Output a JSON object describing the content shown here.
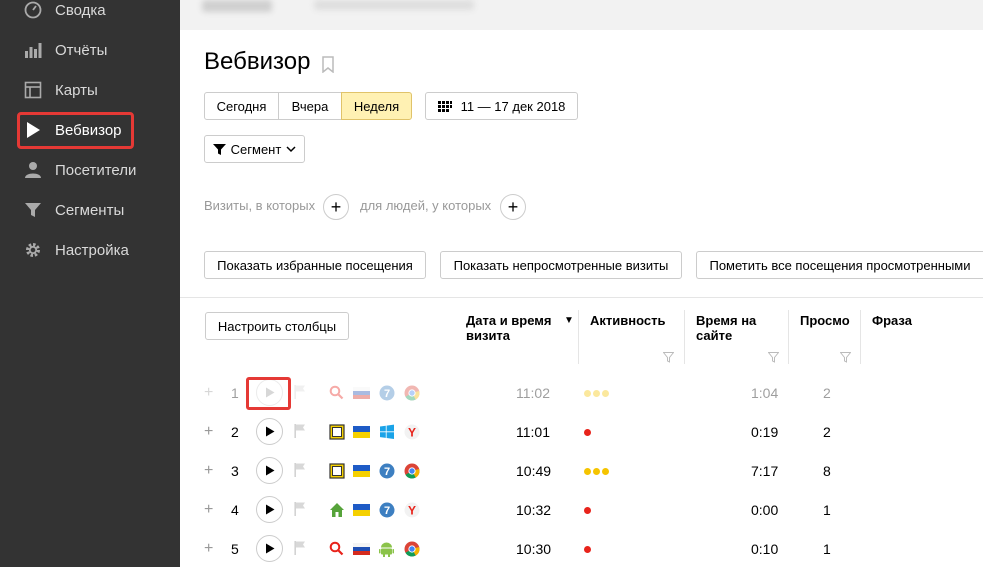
{
  "sidebar": {
    "items": [
      {
        "label": "Сводка",
        "icon": "gauge-icon"
      },
      {
        "label": "Отчёты",
        "icon": "bar-chart-icon"
      },
      {
        "label": "Карты",
        "icon": "map-icon"
      },
      {
        "label": "Вебвизор",
        "icon": "play-icon"
      },
      {
        "label": "Посетители",
        "icon": "person-icon"
      },
      {
        "label": "Сегменты",
        "icon": "filter-icon"
      },
      {
        "label": "Настройка",
        "icon": "gear-icon"
      }
    ],
    "active_index": 3
  },
  "page": {
    "title": "Вебвизор"
  },
  "period": {
    "options": [
      "Сегодня",
      "Вчера",
      "Неделя"
    ],
    "selected": "Неделя",
    "date_range": "11 — 17 дек 2018"
  },
  "segment_button": "Сегмент",
  "filters": {
    "visits_label": "Визиты, в которых",
    "people_label": "для людей, у которых",
    "add_symbol": "+"
  },
  "actions": {
    "show_favorites": "Показать избранные посещения",
    "show_unviewed": "Показать непросмотренные визиты",
    "mark_all_viewed": "Пометить все посещения просмотренными"
  },
  "table": {
    "configure_columns": "Настроить столбцы",
    "headers": {
      "datetime": "Дата и время визита",
      "sort_indicator": "▼",
      "activity": "Активность",
      "time_on_site": "Время на сайте",
      "views": "Просмо",
      "phrase": "Фраза"
    },
    "rows": [
      {
        "num": "1",
        "time": "11:02",
        "activity": 3,
        "duration": "1:04",
        "views": "2",
        "source": "search",
        "country": "ru",
        "os": "windows7",
        "browser": "chrome",
        "viewed": true
      },
      {
        "num": "2",
        "time": "11:01",
        "activity": 1,
        "duration": "0:19",
        "views": "2",
        "source": "direct",
        "country": "ua",
        "os": "windows",
        "browser": "yandex",
        "viewed": false
      },
      {
        "num": "3",
        "time": "10:49",
        "activity": 3,
        "duration": "7:17",
        "views": "8",
        "source": "direct",
        "country": "ua",
        "os": "windows7",
        "browser": "chrome",
        "viewed": false
      },
      {
        "num": "4",
        "time": "10:32",
        "activity": 1,
        "duration": "0:00",
        "views": "1",
        "source": "internal",
        "country": "ua",
        "os": "windows7",
        "browser": "yandex",
        "viewed": false
      },
      {
        "num": "5",
        "time": "10:30",
        "activity": 1,
        "duration": "0:10",
        "views": "1",
        "source": "search",
        "country": "ru",
        "os": "android",
        "browser": "chrome",
        "viewed": false
      }
    ]
  },
  "colors": {
    "sidebar_bg": "#333333",
    "highlight": "#e53935",
    "selected_tab": "#fff1b3",
    "activity_high": "#f5c400",
    "activity_low": "#e8231b"
  }
}
